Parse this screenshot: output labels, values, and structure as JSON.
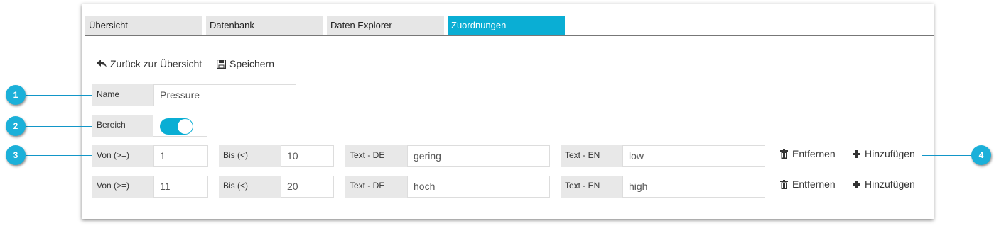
{
  "tabs": [
    {
      "label": "Übersicht",
      "active": false
    },
    {
      "label": "Datenbank",
      "active": false
    },
    {
      "label": "Daten Explorer",
      "active": false
    },
    {
      "label": "Zuordnungen",
      "active": true
    }
  ],
  "actions": {
    "back_label": "Zurück zur Übersicht",
    "save_label": "Speichern"
  },
  "form": {
    "name_label": "Name",
    "name_value": "Pressure",
    "bereich_label": "Bereich",
    "bereich_on": true
  },
  "ranges": [
    {
      "von_label": "Von (>=)",
      "von": "1",
      "bis_label": "Bis (<)",
      "bis": "10",
      "text_de_label": "Text - DE",
      "text_de": "gering",
      "text_en_label": "Text - EN",
      "text_en": "low",
      "remove_label": "Entfernen",
      "add_label": "Hinzufügen"
    },
    {
      "von_label": "Von (>=)",
      "von": "11",
      "bis_label": "Bis (<)",
      "bis": "20",
      "text_de_label": "Text - DE",
      "text_de": "hoch",
      "text_en_label": "Text - EN",
      "text_en": "high",
      "remove_label": "Entfernen",
      "add_label": "Hinzufügen"
    }
  ],
  "callouts": [
    "1",
    "2",
    "3",
    "4"
  ],
  "colors": {
    "accent": "#0aaed4",
    "callout": "#1bb0d9",
    "label_bg": "#e8e8e8",
    "tab_bg": "#e6e6e6"
  }
}
